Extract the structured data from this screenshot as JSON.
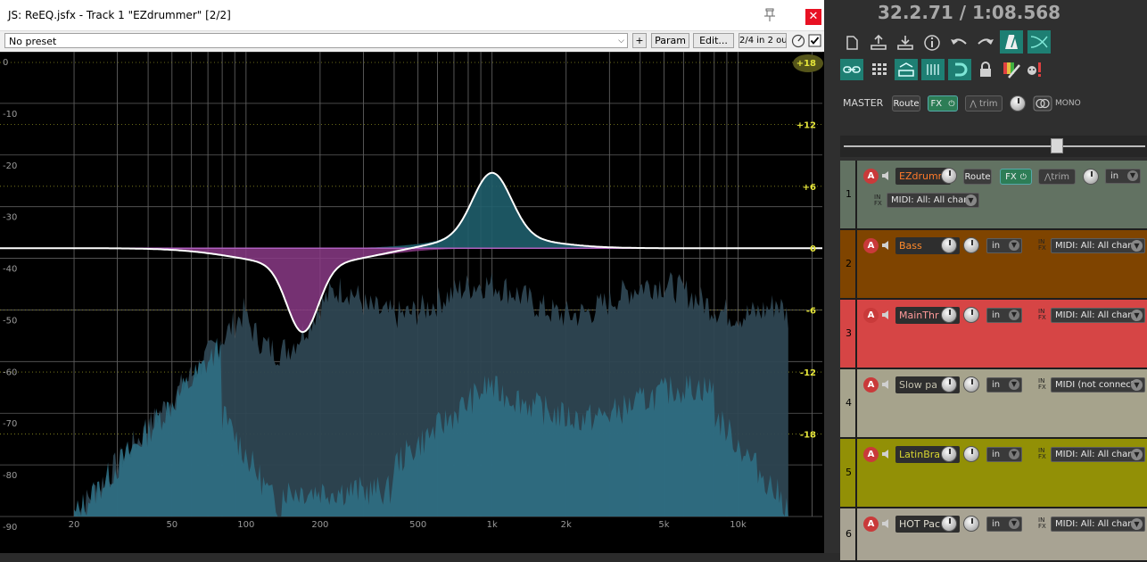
{
  "plugin": {
    "title": "JS: ReEQ.jsfx - Track 1 \"EZdrummer\" [2/2]",
    "preset": "No preset",
    "plus_label": "+",
    "param_label": "Param",
    "edit_label": "Edit...",
    "io_label": "2/4 in 2 ou",
    "close_label": "✕",
    "db_labels_left": [
      "0",
      "-10",
      "-20",
      "-30",
      "-40",
      "-50",
      "-60",
      "-70",
      "-80",
      "-90"
    ],
    "gain_labels_right": [
      "+18",
      "+12",
      "+6",
      "0",
      "-6",
      "-12",
      "-18"
    ],
    "freq_labels": [
      "20",
      "50",
      "100",
      "200",
      "500",
      "1k",
      "2k",
      "5k",
      "10k"
    ],
    "band_cut": {
      "freq_hz": 170,
      "gain_db": -6.5,
      "color": "#8a3a86"
    },
    "band_boost": {
      "freq_hz": 1000,
      "gain_db": 6.2,
      "color": "#1f5e6c"
    }
  },
  "transport": {
    "time": "32.2.71 / 1:08.568"
  },
  "master": {
    "label": "MASTER",
    "route_label": "Route",
    "fx_label": "FX",
    "trim_label": "trim",
    "mono_label": "MONO"
  },
  "tracks": [
    {
      "num": "1",
      "name": "EZdrummer",
      "route_label": "Route",
      "fx_label": "FX",
      "trim_label": "trim",
      "in_label": "in",
      "midi": "MIDI: All: All chan",
      "color": "#627262",
      "name_color": "#ff7a2a"
    },
    {
      "num": "2",
      "name": "Bass",
      "in_label": "in",
      "midi": "MIDI: All: All chan",
      "color": "#7f4400",
      "name_color": "#ff8a2a"
    },
    {
      "num": "3",
      "name": "MainThr",
      "in_label": "in",
      "midi": "MIDI: All: All chan",
      "color": "#d64545",
      "name_color": "#ff9a9a"
    },
    {
      "num": "4",
      "name": "Slow pa",
      "in_label": "in",
      "midi": "MIDI (not connect",
      "color": "#a6a38c",
      "name_color": "#c4c1ae"
    },
    {
      "num": "5",
      "name": "LatinBra",
      "in_label": "in",
      "midi": "MIDI: All: All chan",
      "color": "#929006",
      "name_color": "#d8d630"
    },
    {
      "num": "6",
      "name": "HOT Pac",
      "in_label": "in",
      "midi": "MIDI: All: All chan",
      "color": "#a8a393",
      "name_color": "#e0ddd0"
    }
  ]
}
